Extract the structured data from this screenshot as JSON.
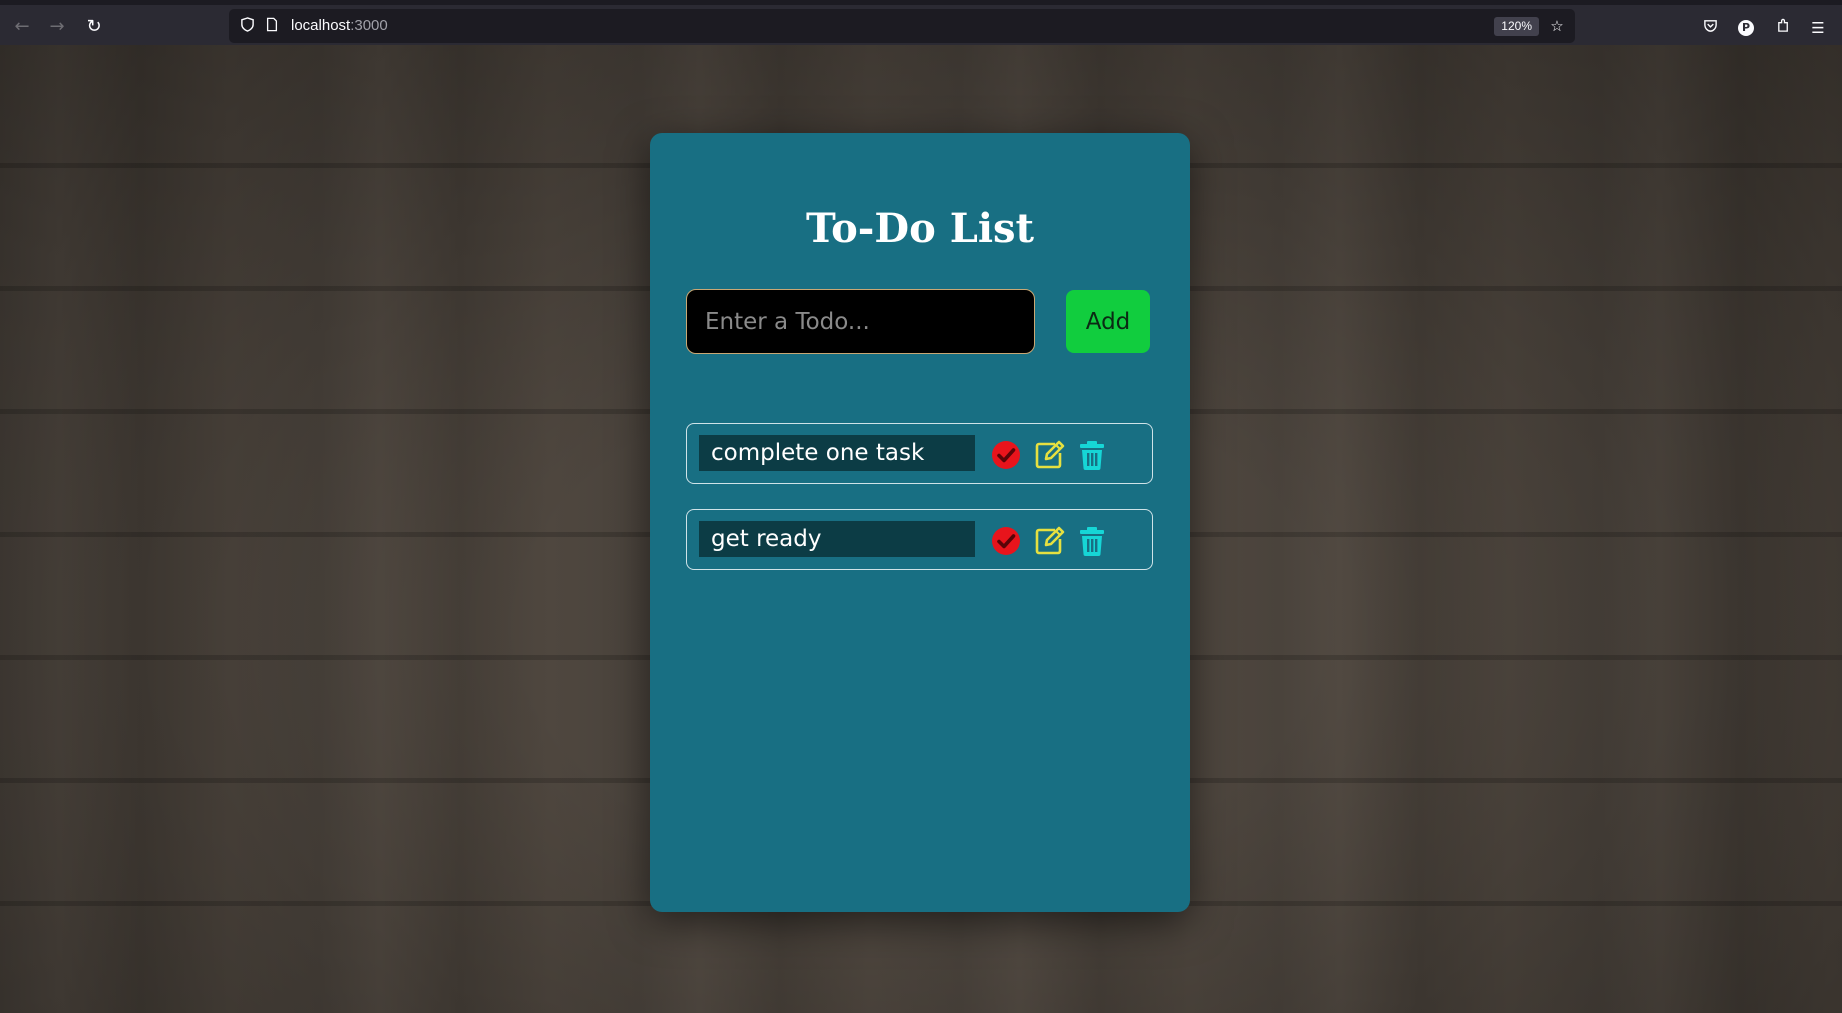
{
  "browser": {
    "url_host": "localhost",
    "url_port": ":3000",
    "zoom": "120%"
  },
  "app": {
    "title": "To-Do List",
    "input": {
      "placeholder": "Enter a Todo...",
      "value": ""
    },
    "add_label": "Add",
    "todos": [
      {
        "text": "complete one task"
      },
      {
        "text": "get ready"
      }
    ]
  },
  "colors": {
    "card": "#186f83",
    "add_button": "#11cd3e",
    "complete_icon": "#e8141c",
    "edit_icon": "#e6e040",
    "delete_icon": "#16d6d6"
  }
}
